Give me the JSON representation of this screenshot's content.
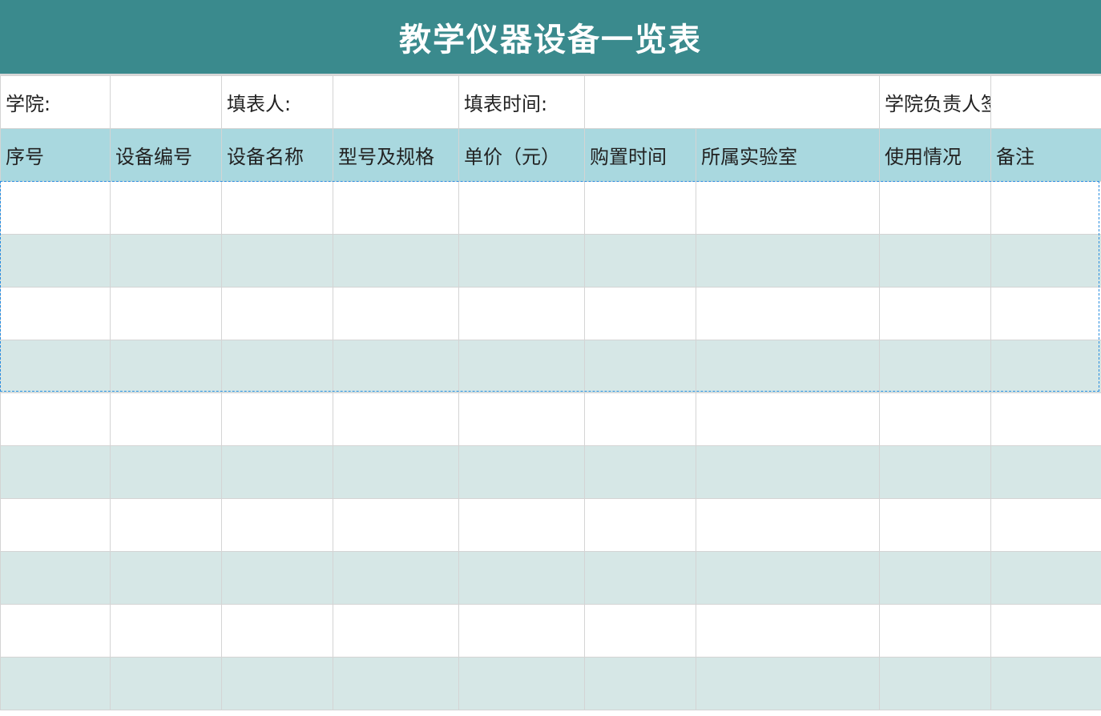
{
  "sheet": {
    "title": "教学仪器设备一览表",
    "info_row": {
      "college_label": "学院:",
      "college_value": "",
      "filler_label": "填表人:",
      "filler_value": "",
      "date_label": "填表时间:",
      "date_value": "",
      "signature_label": "学院负责人签名:",
      "signature_value": ""
    },
    "columns": [
      "序号",
      "设备编号",
      "设备名称",
      "型号及规格",
      "单价（元）",
      "购置时间",
      "所属实验室",
      "使用情况",
      "备注"
    ],
    "rows": [
      [
        "",
        "",
        "",
        "",
        "",
        "",
        "",
        "",
        ""
      ],
      [
        "",
        "",
        "",
        "",
        "",
        "",
        "",
        "",
        ""
      ],
      [
        "",
        "",
        "",
        "",
        "",
        "",
        "",
        "",
        ""
      ],
      [
        "",
        "",
        "",
        "",
        "",
        "",
        "",
        "",
        ""
      ],
      [
        "",
        "",
        "",
        "",
        "",
        "",
        "",
        "",
        ""
      ],
      [
        "",
        "",
        "",
        "",
        "",
        "",
        "",
        "",
        ""
      ],
      [
        "",
        "",
        "",
        "",
        "",
        "",
        "",
        "",
        ""
      ],
      [
        "",
        "",
        "",
        "",
        "",
        "",
        "",
        "",
        ""
      ],
      [
        "",
        "",
        "",
        "",
        "",
        "",
        "",
        "",
        ""
      ],
      [
        "",
        "",
        "",
        "",
        "",
        "",
        "",
        "",
        ""
      ]
    ]
  },
  "colors": {
    "title_bg": "#3a8a8d",
    "header_bg": "#a9d8df",
    "alt_row_bg": "#d6e7e6",
    "selection_border": "#2a8fe0"
  }
}
